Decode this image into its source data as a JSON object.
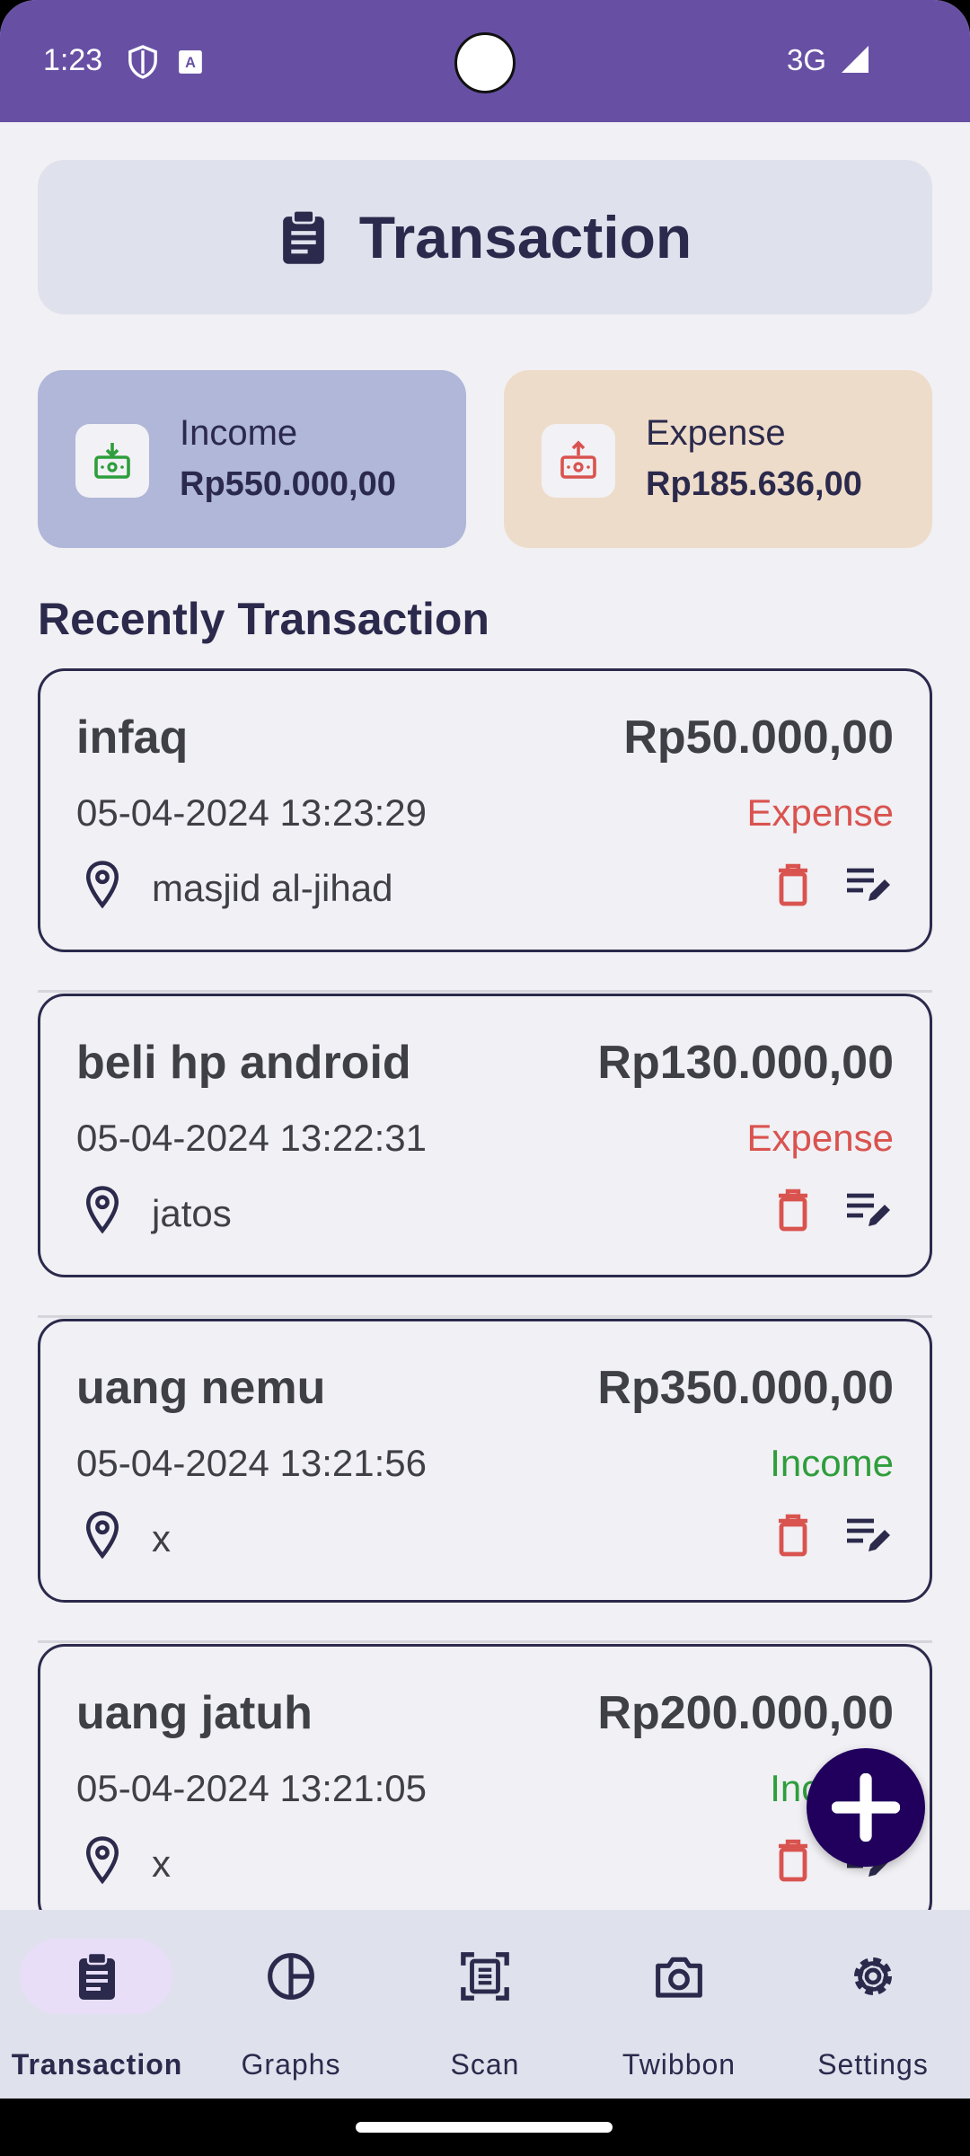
{
  "status_bar": {
    "time": "1:23",
    "network": "3G"
  },
  "header": {
    "title": "Transaction",
    "icon": "clipboard-icon"
  },
  "summary": {
    "income": {
      "label": "Income",
      "value": "Rp550.000,00",
      "icon": "cash-in-icon",
      "color": "#2e9e3c"
    },
    "expense": {
      "label": "Expense",
      "value": "Rp185.636,00",
      "icon": "cash-out-icon",
      "color": "#d9534f"
    }
  },
  "section_title": "Recently Transaction",
  "transactions": [
    {
      "title": "infaq",
      "amount": "Rp50.000,00",
      "date": "05-04-2024 13:23:29",
      "type": "Expense",
      "location": "masjid al-jihad"
    },
    {
      "title": "beli hp android",
      "amount": "Rp130.000,00",
      "date": "05-04-2024 13:22:31",
      "type": "Expense",
      "location": "jatos"
    },
    {
      "title": "uang nemu",
      "amount": "Rp350.000,00",
      "date": "05-04-2024 13:21:56",
      "type": "Income",
      "location": "x"
    },
    {
      "title": "uang jatuh",
      "amount": "Rp200.000,00",
      "date": "05-04-2024 13:21:05",
      "type": "Income",
      "location": "x"
    }
  ],
  "fab": {
    "icon": "plus-icon"
  },
  "nav": {
    "items": [
      {
        "label": "Transaction",
        "icon": "clipboard-icon",
        "active": true
      },
      {
        "label": "Graphs",
        "icon": "pie-chart-icon",
        "active": false
      },
      {
        "label": "Scan",
        "icon": "scan-document-icon",
        "active": false
      },
      {
        "label": "Twibbon",
        "icon": "camera-icon",
        "active": false
      },
      {
        "label": "Settings",
        "icon": "gear-icon",
        "active": false
      }
    ]
  },
  "colors": {
    "primary": "#6750a4",
    "fab": "#21005d",
    "expense": "#d9534f",
    "income": "#2e9e3c"
  }
}
